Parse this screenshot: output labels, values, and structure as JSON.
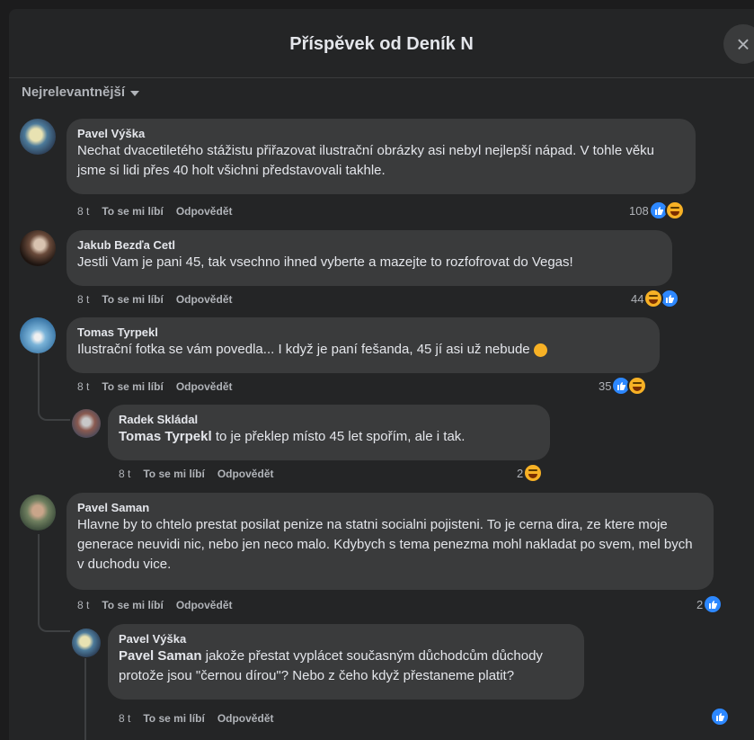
{
  "header": {
    "title": "Příspěvek od Deník N",
    "close_icon": "×"
  },
  "sort": {
    "label": "Nejrelevantnější"
  },
  "labels": {
    "like": "To se mi líbí",
    "reply": "Odpovědět"
  },
  "comments": [
    {
      "author": "Pavel Výška",
      "text": "Nechat dvacetiletého stážistu přiřazovat ilustrační obrázky asi nebyl nejlepší nápad. V tohle věku jsme si lidi přes 40 holt všichni představovali takhle.",
      "time": "8 t",
      "count": "108",
      "reactions": [
        "like",
        "haha"
      ]
    },
    {
      "author": "Jakub Bezďa Cetl",
      "text": "Jestli Vam je pani 45, tak vsechno ihned vyberte a mazejte to rozfofrovat do Vegas!",
      "time": "8 t",
      "count": "44",
      "reactions": [
        "haha",
        "like"
      ]
    },
    {
      "author": "Tomas Tyrpekl",
      "text": "Ilustrační fotka se vám povedla... I když je paní fešanda, 45 jí asi už nebude",
      "time": "8 t",
      "count": "35",
      "reactions": [
        "like",
        "haha"
      ]
    },
    {
      "author": "Radek Skládal",
      "mention": "Tomas Tyrpekl",
      "text": " to je překlep místo 45 let spořím, ale i tak.",
      "time": "8 t",
      "count": "2",
      "reactions": [
        "haha"
      ]
    },
    {
      "author": "Pavel Saman",
      "text": "Hlavne by to chtelo prestat posilat penize na statni socialni pojisteni. To je cerna dira, ze ktere moje generace neuvidi nic, nebo jen neco malo. Kdybych s tema penezma mohl nakladat po svem, mel bych v duchodu vice.",
      "time": "8 t",
      "count": "2",
      "reactions": [
        "like"
      ]
    },
    {
      "author": "Pavel Výška",
      "mention": "Pavel Saman",
      "text": " jakože přestat vyplácet současným důchodcům důchody protože jsou \"černou dírou\"? Nebo z čeho když přestaneme platit?",
      "time": "8 t",
      "count": "",
      "reactions": [
        "like"
      ]
    }
  ]
}
